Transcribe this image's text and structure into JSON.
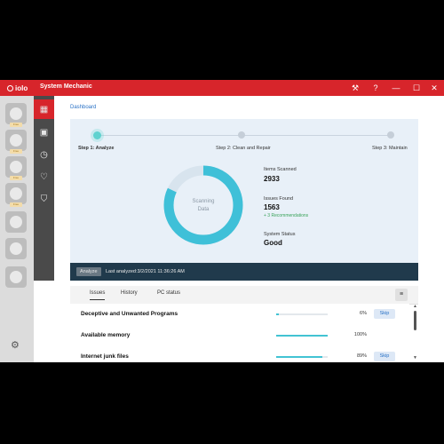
{
  "app": {
    "logo_text": "iolo",
    "title": "System Mechanic",
    "colors": {
      "brand": "#d7252b",
      "accent": "#42c3d3",
      "status_bar": "#203a4c"
    },
    "controls": [
      {
        "name": "tools-button",
        "icon": "wrench-icon",
        "glyph": "🔧"
      },
      {
        "name": "help-button",
        "icon": "help-icon",
        "glyph": "?"
      },
      {
        "name": "minimize-button",
        "icon": "minimize-icon",
        "glyph": "—"
      },
      {
        "name": "maximize-button",
        "icon": "maximize-icon",
        "glyph": "☐"
      },
      {
        "name": "close-button",
        "icon": "close-icon",
        "glyph": "✕"
      }
    ]
  },
  "left_rail": {
    "items": [
      {
        "name": "rail-pc-speed",
        "icon": "speedometer-icon",
        "badge": "Free"
      },
      {
        "name": "rail-privacy",
        "icon": "eye-slash-icon",
        "badge": "Free"
      },
      {
        "name": "rail-optimize",
        "icon": "figure-icon",
        "badge": "Free"
      },
      {
        "name": "rail-repair",
        "icon": "plus-icon",
        "badge": "Free"
      },
      {
        "name": "rail-security",
        "icon": "shield-icon",
        "badge": ""
      },
      {
        "name": "rail-recovery",
        "icon": "lifebuoy-icon",
        "badge": ""
      },
      {
        "name": "rail-drive",
        "icon": "disk-icon",
        "badge": ""
      }
    ],
    "settings_icon": "gear-icon"
  },
  "nav_rail": {
    "items": [
      {
        "name": "nav-dashboard",
        "icon": "grid-icon",
        "glyph": "▦",
        "active": true
      },
      {
        "name": "nav-toolbox",
        "icon": "briefcase-icon",
        "glyph": "💼",
        "active": false
      },
      {
        "name": "nav-history",
        "icon": "clock-icon",
        "glyph": "◷",
        "active": false
      },
      {
        "name": "nav-live-boost",
        "icon": "heartbeat-icon",
        "glyph": "♡",
        "active": false
      },
      {
        "name": "nav-protection",
        "icon": "shield-check-icon",
        "glyph": "⛉",
        "active": false
      }
    ]
  },
  "breadcrumb": "Dashboard",
  "steps": [
    {
      "label": "Step 1: Analyze",
      "active": true
    },
    {
      "label": "Step 2: Clean and Repair",
      "active": false
    },
    {
      "label": "Step 3: Maintain",
      "active": false
    }
  ],
  "scan": {
    "label": "Scanning Data",
    "label_line1": "Scanning",
    "label_line2": "Data",
    "progress": 0.82
  },
  "stats": {
    "items_scanned_label": "Items Scanned",
    "items_scanned_value": "2933",
    "issues_found_label": "Issues Found",
    "issues_found_value": "1563",
    "recommendations": "+ 3 Recommendations",
    "system_status_label": "System Status",
    "system_status_value": "Good"
  },
  "status_bar": {
    "analyze_button": "Analyze",
    "last_analyzed": "Last analyzed:3/2/2021 11:36:26 AM"
  },
  "tabs": [
    {
      "label": "Issues",
      "active": true
    },
    {
      "label": "History",
      "active": false
    },
    {
      "label": "PC status",
      "active": false
    }
  ],
  "issues": [
    {
      "name": "Deceptive and Unwanted Programs",
      "percent_label": "6%",
      "progress": 0.06,
      "skip": "Skip"
    },
    {
      "name": "Available memory",
      "percent_label": "100%",
      "progress": 1.0,
      "skip": ""
    },
    {
      "name": "Internet junk files",
      "percent_label": "89%",
      "progress": 0.89,
      "skip": "Skip"
    }
  ]
}
